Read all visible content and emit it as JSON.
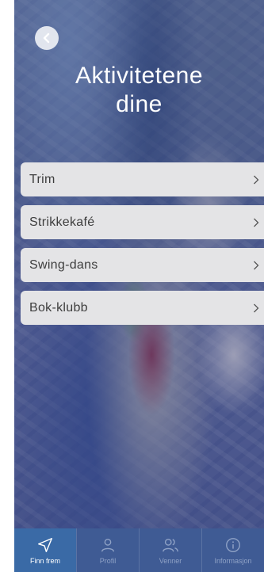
{
  "header": {
    "title_line1": "Aktivitetene",
    "title_line2": "dine"
  },
  "activities": [
    {
      "label": "Trim"
    },
    {
      "label": "Strikkekafé"
    },
    {
      "label": "Swing-dans"
    },
    {
      "label": "Bok-klubb"
    }
  ],
  "tabs": [
    {
      "label": "Finn frem",
      "icon": "navigation-arrow-icon",
      "active": true
    },
    {
      "label": "Profil",
      "icon": "person-icon",
      "active": false
    },
    {
      "label": "Venner",
      "icon": "people-icon",
      "active": false
    },
    {
      "label": "Informasjon",
      "icon": "info-icon",
      "active": false
    }
  ],
  "colors": {
    "tabbar": "#3f5b94",
    "tab_active": "#3a6aa6",
    "row_bg": "#e4e4e6"
  }
}
